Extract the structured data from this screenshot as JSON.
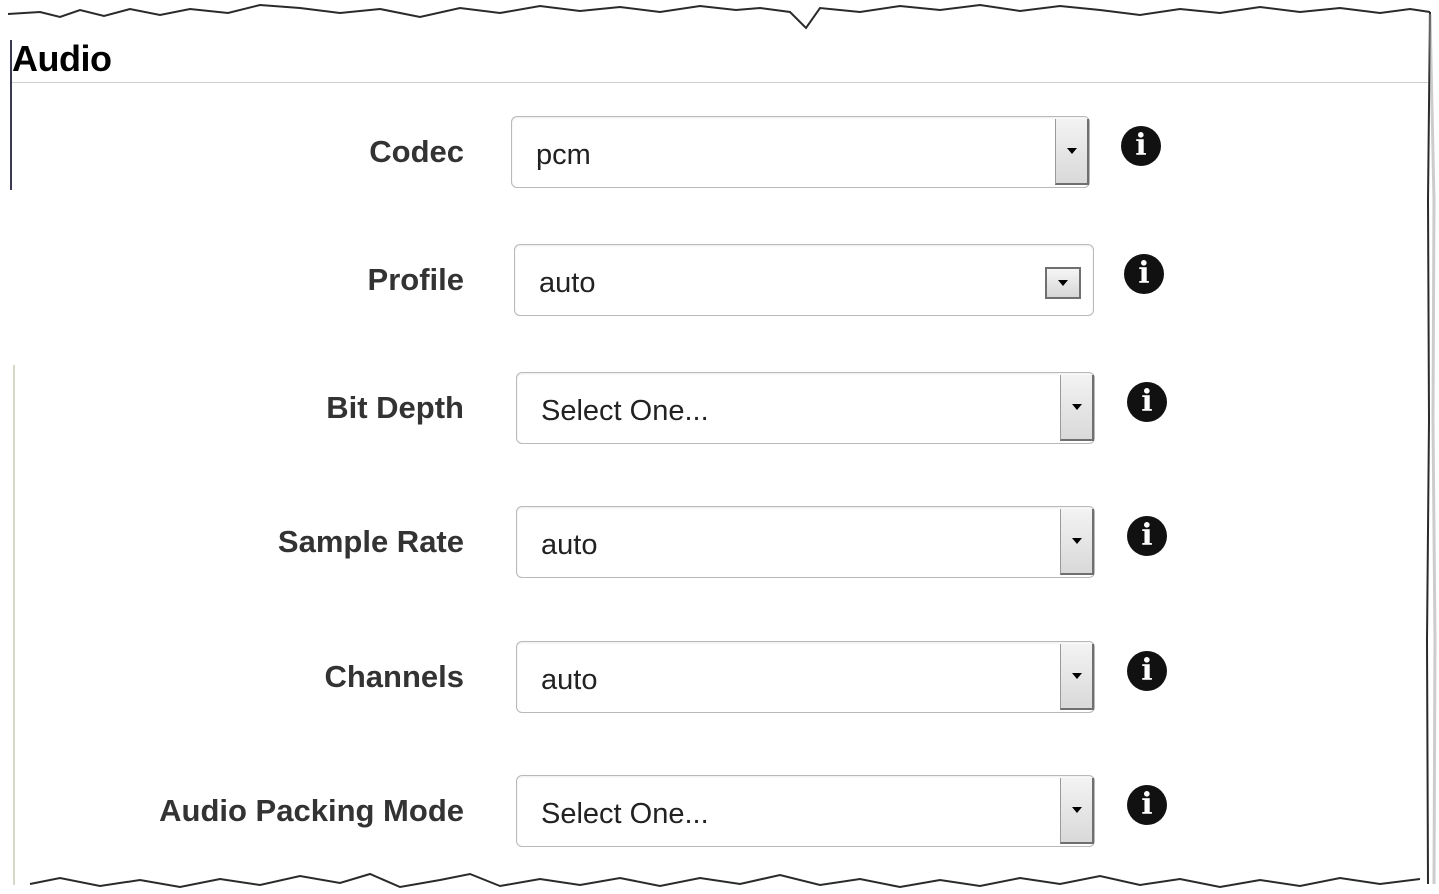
{
  "section": {
    "title": "Audio"
  },
  "fields": [
    {
      "label": "Codec",
      "value": "pcm",
      "info_icon": "info-icon"
    },
    {
      "label": "Profile",
      "value": "auto",
      "info_icon": "info-icon"
    },
    {
      "label": "Bit Depth",
      "value": "Select One...",
      "info_icon": "info-icon"
    },
    {
      "label": "Sample Rate",
      "value": "auto",
      "info_icon": "info-icon"
    },
    {
      "label": "Channels",
      "value": "auto",
      "info_icon": "info-icon"
    },
    {
      "label": "Audio Packing Mode",
      "value": "Select One...",
      "info_icon": "info-icon"
    }
  ],
  "icons": {
    "info_glyph": "i",
    "dropdown": "chevron-down-icon"
  },
  "colors": {
    "label_text": "#333333",
    "title_text": "#000000",
    "select_border": "#b9b9b9",
    "info_icon_bg": "#111111"
  }
}
